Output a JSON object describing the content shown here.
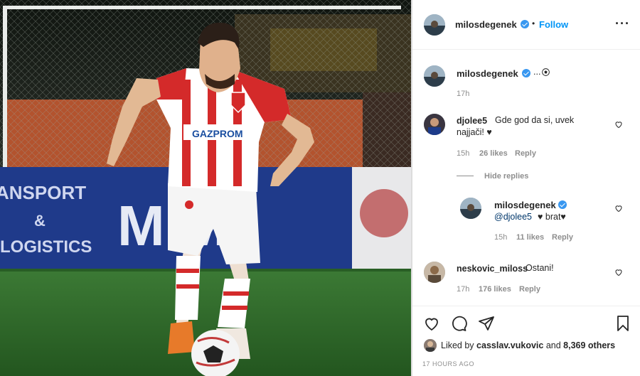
{
  "post": {
    "author": "milosdegenek",
    "follow_label": "Follow",
    "caption_text": "...",
    "caption_time": "17h",
    "liked_by_prefix": "Liked by",
    "liked_by_user": "casslav.vukovic",
    "liked_by_and": "and",
    "liked_by_count": "8,369 others",
    "posted_ago": "17 HOURS AGO"
  },
  "photo": {
    "banner_left_line1": "ANSPORT",
    "banner_left_line2": "&",
    "banner_left_line3": "LOGISTICS",
    "banner_center": "M  M",
    "jersey_sponsor": "GAZPROM"
  },
  "comments": [
    {
      "user": "djolee5",
      "text": "Gde god da si, uvek najjači! ♥",
      "time": "15h",
      "likes": "26 likes",
      "reply": "Reply"
    },
    {
      "user": "neskovic_miloss",
      "text": "Ostani!",
      "time": "17h",
      "likes": "176 likes",
      "reply": "Reply"
    }
  ],
  "hide_replies_label": "Hide replies",
  "reply": {
    "user": "milosdegenek",
    "mention": "@djolee5",
    "text": "♥ brat♥",
    "time": "15h",
    "likes": "11 likes",
    "reply": "Reply"
  },
  "colors": {
    "accent": "#0095f6",
    "verified": "#3897f0",
    "jersey_red": "#d42a2a",
    "pitch": "#2f6a2c"
  }
}
